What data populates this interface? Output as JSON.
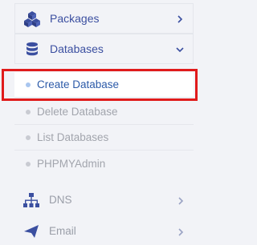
{
  "sidebar": {
    "packages": {
      "label": "Packages",
      "icon": "cubes-icon"
    },
    "databases": {
      "label": "Databases",
      "icon": "database-icon",
      "submenu": [
        {
          "label": "Create Database",
          "active": true
        },
        {
          "label": "Delete Database"
        },
        {
          "label": "List Databases"
        },
        {
          "label": "PHPMYAdmin"
        }
      ]
    },
    "dns": {
      "label": "DNS",
      "icon": "sitemap-icon"
    },
    "email": {
      "label": "Email",
      "icon": "paper-plane-icon"
    }
  },
  "colors": {
    "accent": "#3b4fa0",
    "highlight_border": "#e01b1b",
    "active_text": "#2c5aa8",
    "muted_text": "#a2a5ad"
  }
}
